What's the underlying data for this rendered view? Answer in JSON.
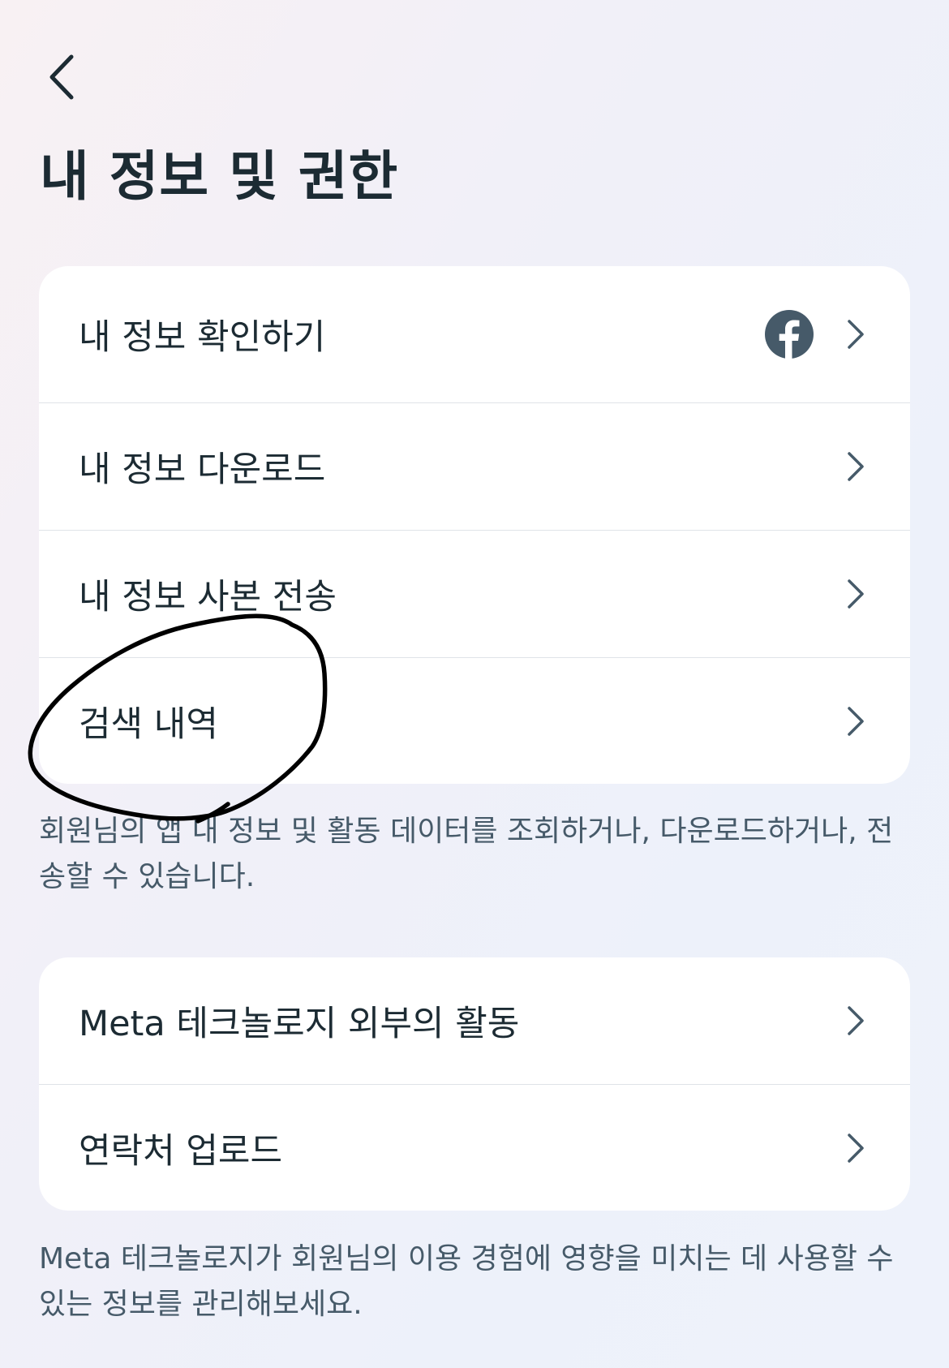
{
  "header": {
    "back_icon": "chevron-left-icon",
    "title": "내 정보 및 권한"
  },
  "section_1": {
    "items": [
      {
        "label": "내 정보 확인하기",
        "icon": "facebook-icon"
      },
      {
        "label": "내 정보 다운로드"
      },
      {
        "label": "내 정보 사본 전송"
      },
      {
        "label": "검색 내역"
      }
    ],
    "description": "회원님의 앱 내 정보 및 활동 데이터를 조회하거나, 다운로드하거나, 전송할 수 있습니다."
  },
  "section_2": {
    "items": [
      {
        "label": "Meta 테크놀로지 외부의 활동"
      },
      {
        "label": "연락처 업로드"
      }
    ],
    "description": "Meta 테크놀로지가 회원님의 이용 경험에 영향을 미치는 데 사용할 수 있는 정보를 관리해보세요."
  },
  "annotation": {
    "type": "hand-drawn-circle",
    "target": "검색 내역",
    "color": "#000000"
  },
  "colors": {
    "text_primary": "#1c2b33",
    "text_secondary": "#465a69",
    "icon": "#465a69",
    "card_background": "#ffffff",
    "divider": "#dfe3e8"
  }
}
